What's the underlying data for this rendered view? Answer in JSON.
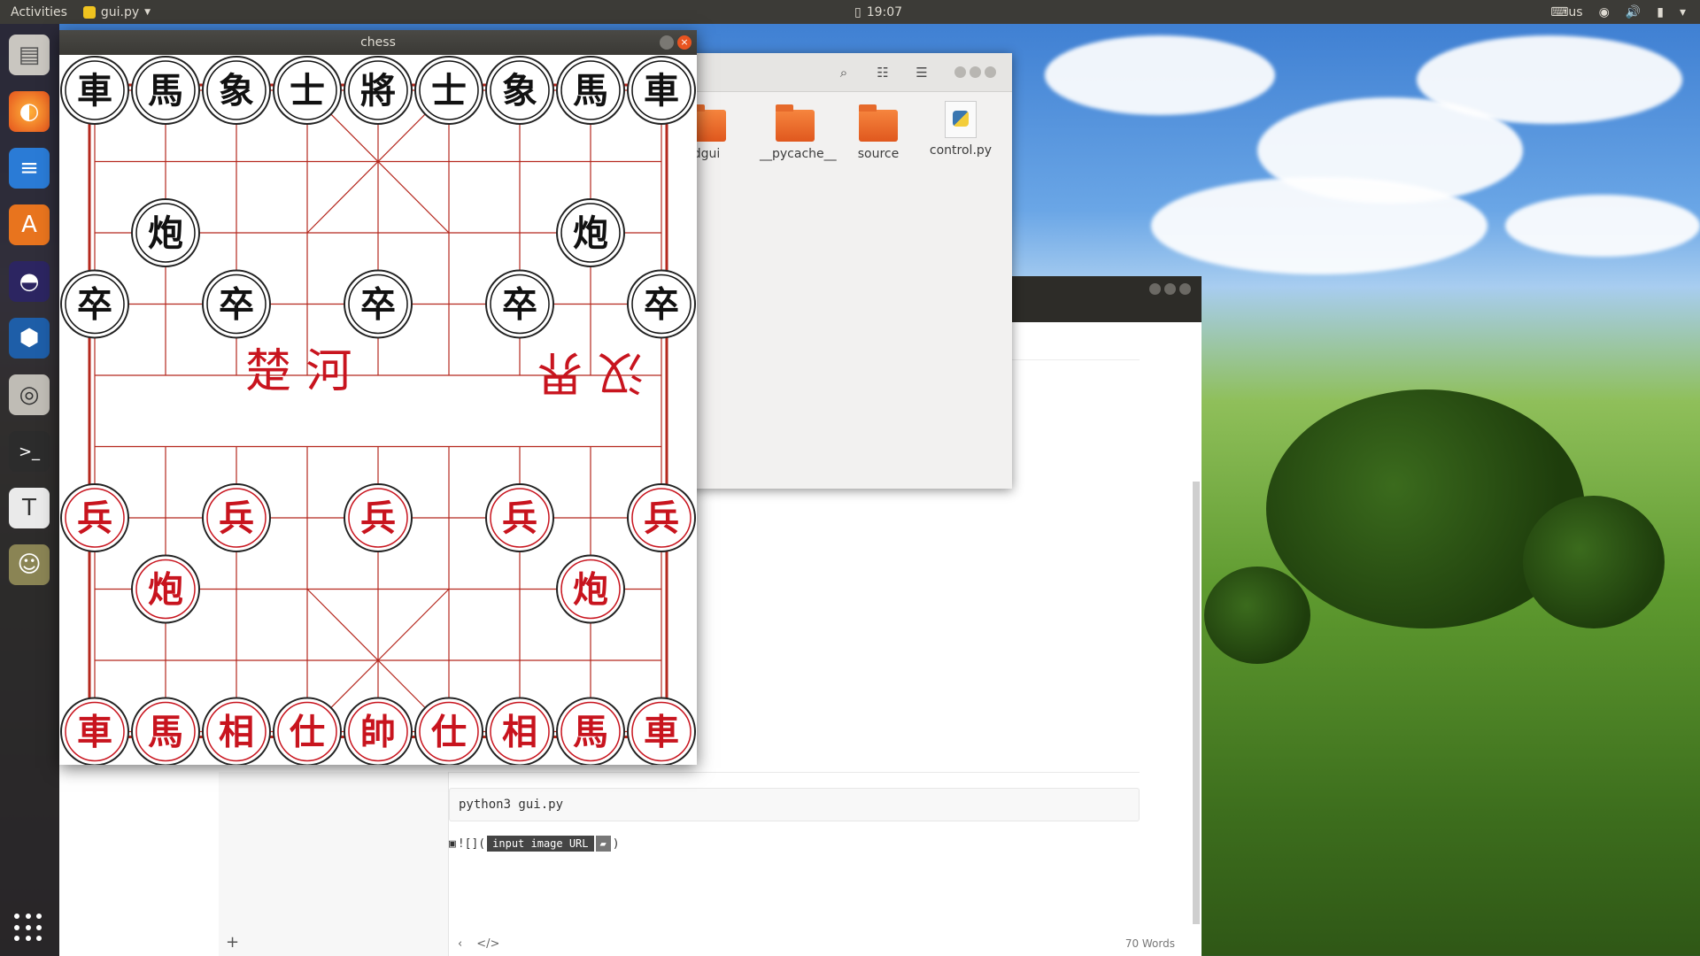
{
  "topbar": {
    "activities": "Activities",
    "app_name": "gui.py",
    "clock": "19:07",
    "keyboard": "us"
  },
  "dock": {
    "items": [
      "files",
      "firefox",
      "writer",
      "software",
      "eclipse",
      "virtualbox",
      "speaker",
      "terminal",
      "text-editor",
      "gimp"
    ]
  },
  "files_window": {
    "items": [
      "dgui",
      "__pycache__",
      "source",
      "control.py"
    ]
  },
  "editor": {
    "code": "python3 gui.py",
    "image_prefix": "![](",
    "image_url_placeholder": "input image URL",
    "image_suffix": ")",
    "word_count": "70 Words"
  },
  "chess_window": {
    "title": "chess",
    "river_left": "楚 河",
    "river_right": "汉 界",
    "black_pieces": [
      {
        "label": "車",
        "col": 0,
        "row": 0
      },
      {
        "label": "馬",
        "col": 1,
        "row": 0
      },
      {
        "label": "象",
        "col": 2,
        "row": 0
      },
      {
        "label": "士",
        "col": 3,
        "row": 0
      },
      {
        "label": "將",
        "col": 4,
        "row": 0
      },
      {
        "label": "士",
        "col": 5,
        "row": 0
      },
      {
        "label": "象",
        "col": 6,
        "row": 0
      },
      {
        "label": "馬",
        "col": 7,
        "row": 0
      },
      {
        "label": "車",
        "col": 8,
        "row": 0
      },
      {
        "label": "炮",
        "col": 1,
        "row": 2
      },
      {
        "label": "炮",
        "col": 7,
        "row": 2
      },
      {
        "label": "卒",
        "col": 0,
        "row": 3
      },
      {
        "label": "卒",
        "col": 2,
        "row": 3
      },
      {
        "label": "卒",
        "col": 4,
        "row": 3
      },
      {
        "label": "卒",
        "col": 6,
        "row": 3
      },
      {
        "label": "卒",
        "col": 8,
        "row": 3
      }
    ],
    "red_pieces": [
      {
        "label": "兵",
        "col": 0,
        "row": 6
      },
      {
        "label": "兵",
        "col": 2,
        "row": 6
      },
      {
        "label": "兵",
        "col": 4,
        "row": 6
      },
      {
        "label": "兵",
        "col": 6,
        "row": 6
      },
      {
        "label": "兵",
        "col": 8,
        "row": 6
      },
      {
        "label": "炮",
        "col": 1,
        "row": 7
      },
      {
        "label": "炮",
        "col": 7,
        "row": 7
      },
      {
        "label": "車",
        "col": 0,
        "row": 9
      },
      {
        "label": "馬",
        "col": 1,
        "row": 9
      },
      {
        "label": "相",
        "col": 2,
        "row": 9
      },
      {
        "label": "仕",
        "col": 3,
        "row": 9
      },
      {
        "label": "帥",
        "col": 4,
        "row": 9
      },
      {
        "label": "仕",
        "col": 5,
        "row": 9
      },
      {
        "label": "相",
        "col": 6,
        "row": 9
      },
      {
        "label": "馬",
        "col": 7,
        "row": 9
      },
      {
        "label": "車",
        "col": 8,
        "row": 9
      }
    ],
    "colors": {
      "line": "#b5281e",
      "black_piece": "#111111",
      "red_piece": "#c8141e"
    }
  }
}
